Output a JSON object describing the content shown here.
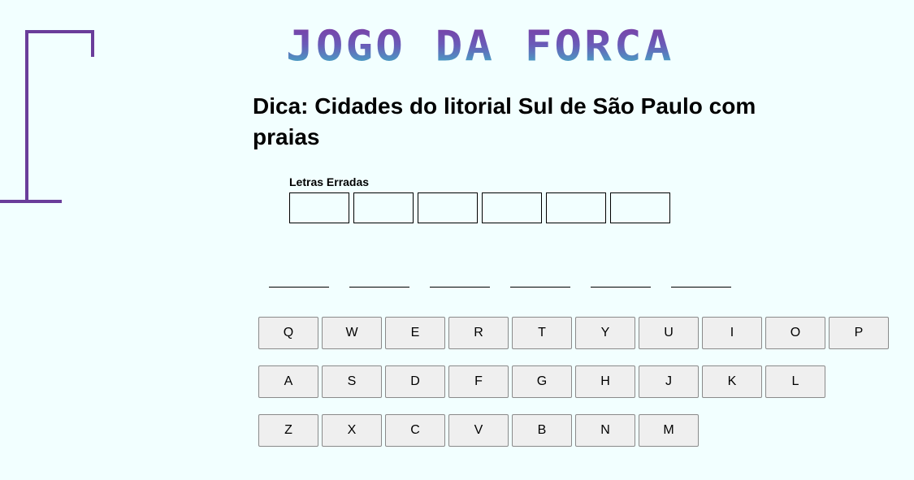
{
  "title": "JOGO DA FORCA",
  "hint": "Dica: Cidades do litorial Sul de São Paulo com praias",
  "wrong_letters": {
    "label": "Letras Erradas",
    "slots": [
      "",
      "",
      "",
      "",
      "",
      ""
    ]
  },
  "word": {
    "blanks": [
      "",
      "",
      "",
      "",
      "",
      ""
    ]
  },
  "keyboard": {
    "rows": [
      [
        "Q",
        "W",
        "E",
        "R",
        "T",
        "Y",
        "U",
        "I",
        "O",
        "P"
      ],
      [
        "A",
        "S",
        "D",
        "F",
        "G",
        "H",
        "J",
        "K",
        "L"
      ],
      [
        "Z",
        "X",
        "C",
        "V",
        "B",
        "N",
        "M"
      ]
    ]
  },
  "colors": {
    "background": "#f2ffff",
    "gallows": "#6a3d9a",
    "title_top": "#7a3fa6",
    "title_bottom": "#3fb3c6"
  }
}
